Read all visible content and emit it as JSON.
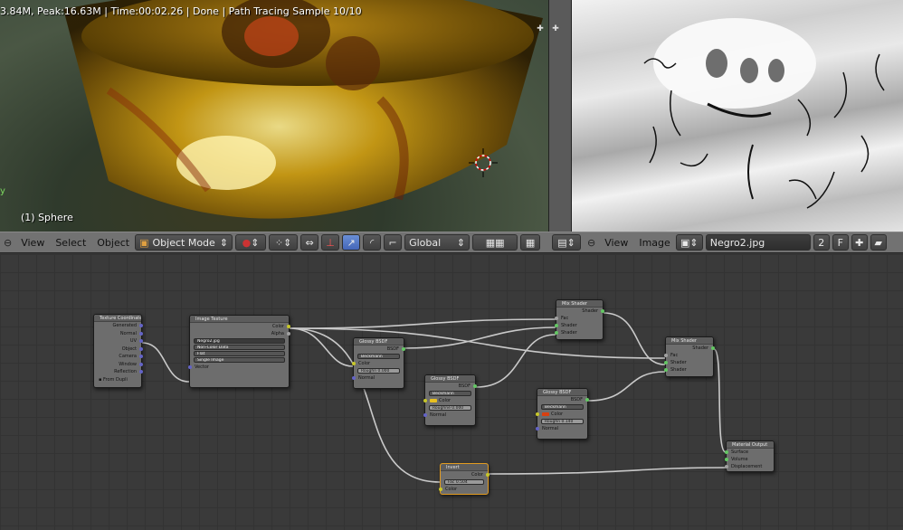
{
  "viewport": {
    "status": "3.84M, Peak:16.63M | Time:00:02.26 | Done | Path Tracing Sample 10/10",
    "object_label": "(1) Sphere",
    "axis": "y"
  },
  "header_left": {
    "menu": [
      "View",
      "Select",
      "Object"
    ],
    "mode": "Object Mode",
    "orientation": "Global"
  },
  "header_right": {
    "menu": [
      "View",
      "Image"
    ],
    "image_name": "Negro2.jpg",
    "users": "2",
    "fake": "F"
  },
  "nodes": {
    "texcoord": {
      "title": "Texture Coordinate",
      "outputs": [
        "Generated",
        "Normal",
        "UV",
        "Object",
        "Camera",
        "Window",
        "Reflection"
      ],
      "from_dupli": "From Dupli"
    },
    "imgtex": {
      "title": "Image Texture",
      "outputs": [
        "Color",
        "Alpha"
      ],
      "image": "Negro2.jpg",
      "colorspace": "Non-Color Data",
      "projection": "Flat",
      "source": "Single Image",
      "input": "Vector"
    },
    "glossy1": {
      "title": "Glossy BSDF",
      "output": "BSDF",
      "dist": "Beckmann",
      "color": "Color",
      "rough": "Roughn 0.000",
      "normal": "Normal"
    },
    "glossy2": {
      "title": "Glossy BSDF",
      "output": "BSDF",
      "dist": "Beckmann",
      "color": "Color",
      "rough": "Roughne 0.000",
      "normal": "Normal",
      "swatch": "#e8c020"
    },
    "glossy3": {
      "title": "Glossy BSDF",
      "output": "BSDF",
      "dist": "Beckmann",
      "color": "Color",
      "rough": "Roughn 0.140",
      "normal": "Normal",
      "swatch": "#d84010"
    },
    "mix1": {
      "title": "Mix Shader",
      "output": "Shader",
      "inputs": [
        "Fac",
        "Shader",
        "Shader"
      ]
    },
    "mix2": {
      "title": "Mix Shader",
      "output": "Shader",
      "inputs": [
        "Fac",
        "Shader",
        "Shader"
      ]
    },
    "invert": {
      "title": "Invert",
      "output": "Color",
      "fac": "Fac 0.504",
      "input": "Color"
    },
    "matout": {
      "title": "Material Output",
      "inputs": [
        "Surface",
        "Volume",
        "Displacement"
      ]
    }
  },
  "colors": {
    "link": "#c9c9c9",
    "selected_outline": "#e29b20"
  }
}
